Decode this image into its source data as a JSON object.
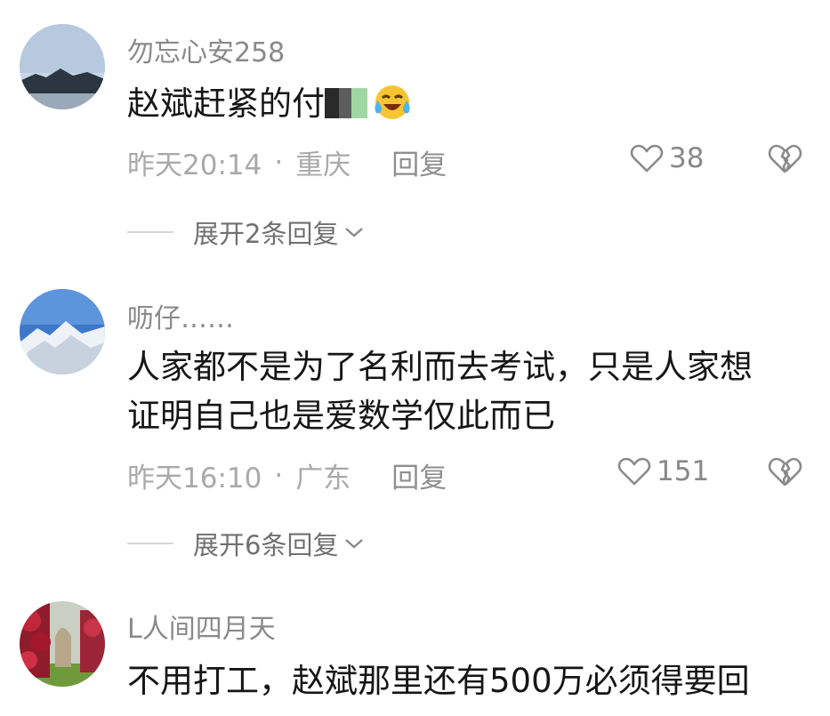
{
  "comments": [
    {
      "username": "勿忘心安258",
      "content_lines": [
        "赵斌赶紧的付"
      ],
      "time": "昨天20:14",
      "separator": "·",
      "location": "重庆",
      "reply_label": "回复",
      "likes": "38",
      "expand_label": "展开2条回复",
      "avatar_icon": "mountain-lake-avatar",
      "trailing_icon": "laughing-tears-emoji"
    },
    {
      "username": "呖仔……",
      "content_lines": [
        "人家都不是为了名利而去考试，只是人家想",
        "证明自己也是爱数学仅此而已"
      ],
      "time": "昨天16:10",
      "separator": "·",
      "location": "广东",
      "reply_label": "回复",
      "likes": "151",
      "expand_label": "展开6条回复",
      "avatar_icon": "snow-mountain-avatar"
    },
    {
      "username": "L人间四月天",
      "content_lines": [
        "不用打工，赵斌那里还有500万必须得要回"
      ],
      "avatar_icon": "flower-garden-avatar"
    }
  ],
  "colors": {
    "username": "#8a8a8a",
    "content": "#161616",
    "meta": "#a9a9a9",
    "expand": "#707070"
  }
}
